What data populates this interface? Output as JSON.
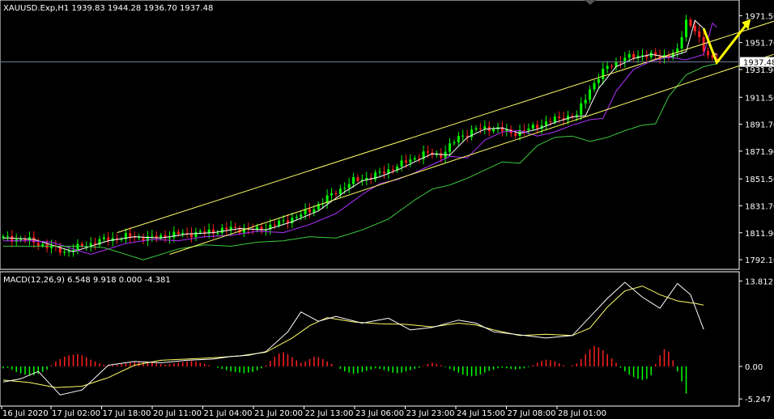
{
  "window": {
    "main_header": "XAUUSD.Exp,H1  1939.83 1944.28 1936.70 1937.48",
    "indicator_header": "MACD(12,26,9) 6.548 9.918 0.000 -4.381"
  },
  "colors": {
    "background": "#000000",
    "frame": "#ffffff",
    "bull": "#00ff00",
    "bear": "#ff2020",
    "channel": "#ffff66",
    "ma_fast": "#ffffff",
    "ma_mid": "#b030ff",
    "ma_slow": "#3cc83c",
    "arrow": "#ffff00",
    "price_line": "#6f7f9f",
    "macd_main": "#ffffff",
    "macd_signal": "#ffff66"
  },
  "chart_data": [
    {
      "type": "candlestick",
      "symbol": "XAUUSD.Exp",
      "timeframe": "H1",
      "ohlc_last": {
        "open": 1939.83,
        "high": 1944.28,
        "low": 1936.7,
        "close": 1937.48
      },
      "ylim": [
        1785.0,
        1983.0
      ],
      "y_ticks": [
        "1971.50",
        "1951.70",
        "1931.90",
        "1911.50",
        "1891.70",
        "1871.90",
        "1851.50",
        "1831.70",
        "1811.90",
        "1792.10"
      ],
      "current_price_label": "1937.48",
      "x_ticks": [
        "16 Jul 2020",
        "17 Jul 02:00",
        "17 Jul 18:00",
        "20 Jul 11:00",
        "21 Jul 04:00",
        "21 Jul 20:00",
        "22 Jul 13:00",
        "23 Jul 06:00",
        "23 Jul 23:00",
        "24 Jul 15:00",
        "27 Jul 08:00",
        "28 Jul 01:00"
      ],
      "price_path": [
        [
          0,
          1808
        ],
        [
          5,
          1807
        ],
        [
          10,
          1802
        ],
        [
          14,
          1798
        ],
        [
          18,
          1802
        ],
        [
          22,
          1806
        ],
        [
          28,
          1809
        ],
        [
          34,
          1808
        ],
        [
          40,
          1811
        ],
        [
          46,
          1812
        ],
        [
          52,
          1815
        ],
        [
          58,
          1814
        ],
        [
          64,
          1820
        ],
        [
          70,
          1828
        ],
        [
          76,
          1842
        ],
        [
          80,
          1850
        ],
        [
          84,
          1853
        ],
        [
          88,
          1858
        ],
        [
          92,
          1864
        ],
        [
          96,
          1870
        ],
        [
          100,
          1869
        ],
        [
          104,
          1882
        ],
        [
          108,
          1888
        ],
        [
          112,
          1889
        ],
        [
          116,
          1885
        ],
        [
          120,
          1888
        ],
        [
          124,
          1893
        ],
        [
          128,
          1897
        ],
        [
          131,
          1898
        ],
        [
          134,
          1918
        ],
        [
          138,
          1934
        ],
        [
          142,
          1940
        ],
        [
          146,
          1943
        ],
        [
          150,
          1941
        ],
        [
          154,
          1945
        ],
        [
          156,
          1968
        ],
        [
          158,
          1962
        ],
        [
          160,
          1945
        ],
        [
          163,
          1937.48
        ]
      ],
      "channel_lines": [
        {
          "from": [
            26,
            1812
          ],
          "to": [
            194,
            1986
          ]
        },
        {
          "from": [
            38,
            1796
          ],
          "to": [
            206,
            1975
          ]
        }
      ]
    },
    {
      "type": "macd",
      "params": [
        12,
        26,
        9
      ],
      "values": {
        "main": 6.548,
        "signal": 9.918,
        "zero": 0.0,
        "histogram": -4.381
      },
      "ylim": [
        -6.4,
        15.3
      ],
      "y_ticks": [
        "13.812",
        "0.00",
        "-5.247"
      ],
      "main_path": [
        [
          0,
          -2.5
        ],
        [
          4,
          -2.0
        ],
        [
          8,
          -0.8
        ],
        [
          13,
          -4.6
        ],
        [
          18,
          -3.8
        ],
        [
          24,
          0.2
        ],
        [
          30,
          0.8
        ],
        [
          36,
          0.6
        ],
        [
          42,
          1.0
        ],
        [
          48,
          1.2
        ],
        [
          52,
          1.6
        ],
        [
          56,
          1.8
        ],
        [
          60,
          2.4
        ],
        [
          65,
          5.6
        ],
        [
          68,
          8.8
        ],
        [
          72,
          7.3
        ],
        [
          76,
          8.1
        ],
        [
          82,
          7.0
        ],
        [
          88,
          7.8
        ],
        [
          93,
          5.9
        ],
        [
          98,
          6.3
        ],
        [
          104,
          7.5
        ],
        [
          108,
          7.0
        ],
        [
          112,
          5.6
        ],
        [
          118,
          5.1
        ],
        [
          124,
          4.6
        ],
        [
          130,
          5.0
        ],
        [
          134,
          8.0
        ],
        [
          138,
          11.0
        ],
        [
          142,
          13.6
        ],
        [
          146,
          11.2
        ],
        [
          150,
          9.4
        ],
        [
          154,
          13.4
        ],
        [
          157,
          11.6
        ],
        [
          160,
          6.0
        ]
      ],
      "signal_path": [
        [
          0,
          -2.2
        ],
        [
          6,
          -2.6
        ],
        [
          12,
          -3.4
        ],
        [
          18,
          -3.2
        ],
        [
          24,
          -1.8
        ],
        [
          30,
          0.2
        ],
        [
          36,
          1.0
        ],
        [
          42,
          1.2
        ],
        [
          48,
          1.4
        ],
        [
          54,
          1.7
        ],
        [
          60,
          2.3
        ],
        [
          66,
          4.6
        ],
        [
          70,
          6.6
        ],
        [
          74,
          7.9
        ],
        [
          80,
          7.2
        ],
        [
          86,
          6.9
        ],
        [
          92,
          6.8
        ],
        [
          98,
          6.4
        ],
        [
          104,
          7.0
        ],
        [
          108,
          6.7
        ],
        [
          112,
          5.9
        ],
        [
          118,
          5.0
        ],
        [
          124,
          5.2
        ],
        [
          130,
          5.0
        ],
        [
          134,
          6.2
        ],
        [
          138,
          9.6
        ],
        [
          142,
          12.2
        ],
        [
          146,
          13.0
        ],
        [
          150,
          11.6
        ],
        [
          154,
          10.6
        ],
        [
          158,
          10.2
        ],
        [
          160,
          9.9
        ]
      ],
      "histogram": [
        -0.3,
        -0.2,
        -0.5,
        -0.9,
        -1.1,
        -1.3,
        -1.5,
        -1.4,
        -1.2,
        -0.9,
        -0.5,
        0.2,
        0.8,
        1.2,
        1.6,
        1.8,
        1.9,
        2.0,
        1.8,
        1.5,
        1.1,
        0.8,
        0.5,
        0.3,
        0.2,
        0.2,
        0.3,
        0.4,
        0.5,
        0.6,
        0.7,
        0.8,
        0.8,
        0.7,
        0.6,
        0.5,
        0.4,
        0.3,
        0.4,
        0.5,
        0.6,
        0.7,
        0.8,
        0.9,
        0.8,
        0.6,
        0.4,
        0.2,
        0.0,
        -0.2,
        -0.4,
        -0.6,
        -0.8,
        -0.9,
        -1.0,
        -1.1,
        -1.0,
        -0.9,
        -0.6,
        -0.3,
        0.2,
        0.9,
        1.6,
        2.1,
        2.3,
        2.0,
        1.5,
        1.0,
        0.6,
        0.8,
        1.2,
        1.6,
        1.5,
        1.2,
        0.8,
        0.4,
        0.0,
        -0.4,
        -0.8,
        -1.0,
        -1.2,
        -1.1,
        -0.9,
        -0.7,
        -0.5,
        -0.3,
        -0.4,
        -0.6,
        -0.8,
        -1.0,
        -1.1,
        -1.0,
        -0.8,
        -0.6,
        -0.4,
        -0.2,
        0.1,
        0.4,
        0.6,
        0.4,
        0.2,
        -0.1,
        -0.4,
        -0.7,
        -1.0,
        -1.3,
        -1.5,
        -1.6,
        -1.5,
        -1.3,
        -1.0,
        -0.7,
        -0.5,
        -0.3,
        -0.2,
        -0.3,
        -0.4,
        -0.5,
        -0.4,
        -0.3,
        -0.1,
        0.2,
        0.6,
        0.9,
        1.1,
        1.0,
        0.8,
        0.5,
        0.2,
        0.0,
        0.2,
        0.5,
        1.2,
        2.0,
        2.8,
        3.3,
        3.1,
        2.6,
        2.0,
        1.3,
        0.6,
        -0.2,
        -0.8,
        -1.3,
        -1.7,
        -2.0,
        -2.2,
        -2.0,
        -1.4,
        0.4,
        1.8,
        2.8,
        2.4,
        1.0,
        -0.8,
        -2.4,
        -4.381
      ]
    }
  ]
}
